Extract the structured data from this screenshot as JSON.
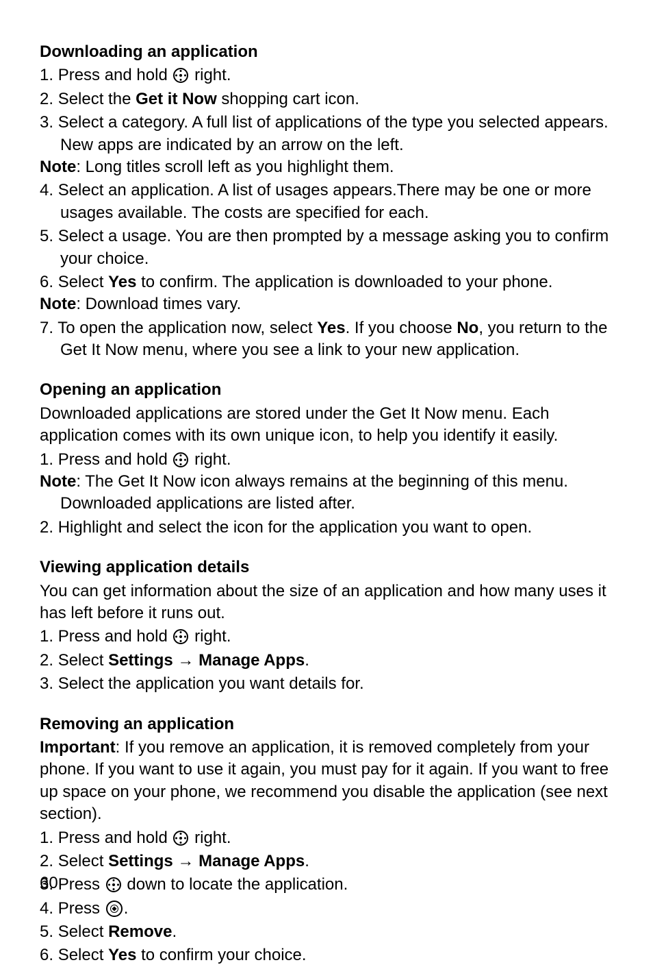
{
  "page_number": "60",
  "sections": [
    {
      "heading": "Downloading an application",
      "intro": null,
      "steps": [
        {
          "n": "1.",
          "pre": "Press and hold ",
          "icon": "nav",
          "post": " right."
        },
        {
          "n": "2.",
          "segments": [
            {
              "t": "Select the "
            },
            {
              "t": "Get it Now",
              "b": true
            },
            {
              "t": " shopping cart icon."
            }
          ]
        },
        {
          "n": "3.",
          "lines": [
            {
              "segments": [
                {
                  "t": "Select a category. A full list of applications of the type you selected appears. New apps are indicated by an arrow on the left."
                }
              ]
            },
            {
              "segments": [
                {
                  "t": "Note",
                  "b": true
                },
                {
                  "t": ": Long titles scroll left as you highlight them."
                }
              ]
            }
          ]
        },
        {
          "n": "4.",
          "segments": [
            {
              "t": "Select an application. A list of usages appears.There may be one or more usages available. The costs are specified for each."
            }
          ]
        },
        {
          "n": "5.",
          "segments": [
            {
              "t": "Select a usage. You are then prompted by a message asking you to confirm your choice."
            }
          ]
        },
        {
          "n": "6.",
          "lines": [
            {
              "segments": [
                {
                  "t": "Select "
                },
                {
                  "t": "Yes",
                  "b": true
                },
                {
                  "t": " to confirm. The application is downloaded to your phone."
                }
              ]
            },
            {
              "segments": [
                {
                  "t": "Note",
                  "b": true
                },
                {
                  "t": ": Download times vary."
                }
              ]
            }
          ]
        },
        {
          "n": "7.",
          "segments": [
            {
              "t": "To open the application now, select "
            },
            {
              "t": "Yes",
              "b": true
            },
            {
              "t": ". If you choose "
            },
            {
              "t": "No",
              "b": true
            },
            {
              "t": ", you return to the Get It Now menu, where you see a link to your new application."
            }
          ]
        }
      ]
    },
    {
      "heading": "Opening an application",
      "intro": "Downloaded applications are stored under the Get It Now menu. Each application comes with its own unique icon, to help you identify it easily.",
      "steps": [
        {
          "n": "1.",
          "lines": [
            {
              "pre": "Press and hold ",
              "icon": "nav",
              "post": " right."
            },
            {
              "segments": [
                {
                  "t": "Note",
                  "b": true
                },
                {
                  "t": ": The Get It Now icon always remains at the beginning of this menu. Downloaded applications are listed after."
                }
              ]
            }
          ]
        },
        {
          "n": "2.",
          "segments": [
            {
              "t": "Highlight and select the icon for the application you want to open."
            }
          ]
        }
      ]
    },
    {
      "heading": "Viewing application details",
      "intro": "You can get information about the size of an application and how many uses it has left before it runs out.",
      "steps": [
        {
          "n": "1.",
          "pre": "Press and hold ",
          "icon": "nav",
          "post": " right."
        },
        {
          "n": "2.",
          "segments": [
            {
              "t": "Select "
            },
            {
              "t": "Settings",
              "b": true
            },
            {
              "t": " "
            },
            {
              "arrow": true
            },
            {
              "t": " "
            },
            {
              "t": "Manage Apps",
              "b": true
            },
            {
              "t": "."
            }
          ]
        },
        {
          "n": "3.",
          "segments": [
            {
              "t": "Select the application you want details for."
            }
          ]
        }
      ]
    },
    {
      "heading": "Removing an application",
      "intro_segments": [
        {
          "t": "Important",
          "b": true
        },
        {
          "t": ": If you remove an application, it is removed completely from your phone. If you want to use it again, you must pay for it again. If you want to free up space on your phone, we recommend you disable the application (see next section)."
        }
      ],
      "steps": [
        {
          "n": "1.",
          "pre": "Press and hold ",
          "icon": "nav",
          "post": " right."
        },
        {
          "n": "2.",
          "segments": [
            {
              "t": "Select "
            },
            {
              "t": "Settings",
              "b": true
            },
            {
              "t": " "
            },
            {
              "arrow": true
            },
            {
              "t": " "
            },
            {
              "t": "Manage Apps",
              "b": true
            },
            {
              "t": "."
            }
          ]
        },
        {
          "n": "3.",
          "pre": "Press ",
          "icon": "nav",
          "post": " down to locate the application."
        },
        {
          "n": "4.",
          "pre": "Press ",
          "icon": "ok",
          "post": "."
        },
        {
          "n": "5.",
          "segments": [
            {
              "t": "Select "
            },
            {
              "t": "Remove",
              "b": true
            },
            {
              "t": "."
            }
          ]
        },
        {
          "n": "6.",
          "segments": [
            {
              "t": "Select "
            },
            {
              "t": "Yes",
              "b": true
            },
            {
              "t": " to confirm your choice."
            }
          ]
        }
      ]
    }
  ],
  "arrow_glyph": "→"
}
